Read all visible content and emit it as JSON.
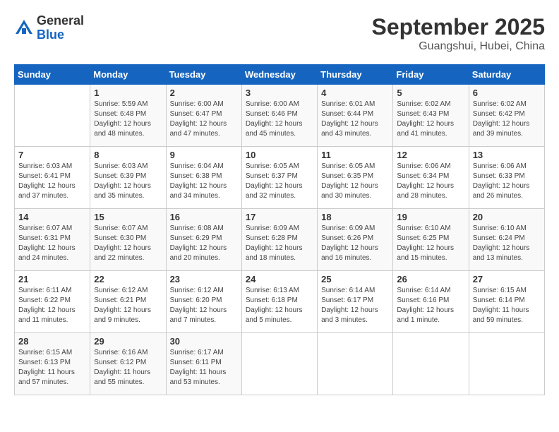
{
  "header": {
    "logo": {
      "general": "General",
      "blue": "Blue"
    },
    "title": "September 2025",
    "subtitle": "Guangshui, Hubei, China"
  },
  "days_of_week": [
    "Sunday",
    "Monday",
    "Tuesday",
    "Wednesday",
    "Thursday",
    "Friday",
    "Saturday"
  ],
  "weeks": [
    [
      {
        "day": "",
        "info": ""
      },
      {
        "day": "1",
        "info": "Sunrise: 5:59 AM\nSunset: 6:48 PM\nDaylight: 12 hours\nand 48 minutes."
      },
      {
        "day": "2",
        "info": "Sunrise: 6:00 AM\nSunset: 6:47 PM\nDaylight: 12 hours\nand 47 minutes."
      },
      {
        "day": "3",
        "info": "Sunrise: 6:00 AM\nSunset: 6:46 PM\nDaylight: 12 hours\nand 45 minutes."
      },
      {
        "day": "4",
        "info": "Sunrise: 6:01 AM\nSunset: 6:44 PM\nDaylight: 12 hours\nand 43 minutes."
      },
      {
        "day": "5",
        "info": "Sunrise: 6:02 AM\nSunset: 6:43 PM\nDaylight: 12 hours\nand 41 minutes."
      },
      {
        "day": "6",
        "info": "Sunrise: 6:02 AM\nSunset: 6:42 PM\nDaylight: 12 hours\nand 39 minutes."
      }
    ],
    [
      {
        "day": "7",
        "info": "Sunrise: 6:03 AM\nSunset: 6:41 PM\nDaylight: 12 hours\nand 37 minutes."
      },
      {
        "day": "8",
        "info": "Sunrise: 6:03 AM\nSunset: 6:39 PM\nDaylight: 12 hours\nand 35 minutes."
      },
      {
        "day": "9",
        "info": "Sunrise: 6:04 AM\nSunset: 6:38 PM\nDaylight: 12 hours\nand 34 minutes."
      },
      {
        "day": "10",
        "info": "Sunrise: 6:05 AM\nSunset: 6:37 PM\nDaylight: 12 hours\nand 32 minutes."
      },
      {
        "day": "11",
        "info": "Sunrise: 6:05 AM\nSunset: 6:35 PM\nDaylight: 12 hours\nand 30 minutes."
      },
      {
        "day": "12",
        "info": "Sunrise: 6:06 AM\nSunset: 6:34 PM\nDaylight: 12 hours\nand 28 minutes."
      },
      {
        "day": "13",
        "info": "Sunrise: 6:06 AM\nSunset: 6:33 PM\nDaylight: 12 hours\nand 26 minutes."
      }
    ],
    [
      {
        "day": "14",
        "info": "Sunrise: 6:07 AM\nSunset: 6:31 PM\nDaylight: 12 hours\nand 24 minutes."
      },
      {
        "day": "15",
        "info": "Sunrise: 6:07 AM\nSunset: 6:30 PM\nDaylight: 12 hours\nand 22 minutes."
      },
      {
        "day": "16",
        "info": "Sunrise: 6:08 AM\nSunset: 6:29 PM\nDaylight: 12 hours\nand 20 minutes."
      },
      {
        "day": "17",
        "info": "Sunrise: 6:09 AM\nSunset: 6:28 PM\nDaylight: 12 hours\nand 18 minutes."
      },
      {
        "day": "18",
        "info": "Sunrise: 6:09 AM\nSunset: 6:26 PM\nDaylight: 12 hours\nand 16 minutes."
      },
      {
        "day": "19",
        "info": "Sunrise: 6:10 AM\nSunset: 6:25 PM\nDaylight: 12 hours\nand 15 minutes."
      },
      {
        "day": "20",
        "info": "Sunrise: 6:10 AM\nSunset: 6:24 PM\nDaylight: 12 hours\nand 13 minutes."
      }
    ],
    [
      {
        "day": "21",
        "info": "Sunrise: 6:11 AM\nSunset: 6:22 PM\nDaylight: 12 hours\nand 11 minutes."
      },
      {
        "day": "22",
        "info": "Sunrise: 6:12 AM\nSunset: 6:21 PM\nDaylight: 12 hours\nand 9 minutes."
      },
      {
        "day": "23",
        "info": "Sunrise: 6:12 AM\nSunset: 6:20 PM\nDaylight: 12 hours\nand 7 minutes."
      },
      {
        "day": "24",
        "info": "Sunrise: 6:13 AM\nSunset: 6:18 PM\nDaylight: 12 hours\nand 5 minutes."
      },
      {
        "day": "25",
        "info": "Sunrise: 6:14 AM\nSunset: 6:17 PM\nDaylight: 12 hours\nand 3 minutes."
      },
      {
        "day": "26",
        "info": "Sunrise: 6:14 AM\nSunset: 6:16 PM\nDaylight: 12 hours\nand 1 minute."
      },
      {
        "day": "27",
        "info": "Sunrise: 6:15 AM\nSunset: 6:14 PM\nDaylight: 11 hours\nand 59 minutes."
      }
    ],
    [
      {
        "day": "28",
        "info": "Sunrise: 6:15 AM\nSunset: 6:13 PM\nDaylight: 11 hours\nand 57 minutes."
      },
      {
        "day": "29",
        "info": "Sunrise: 6:16 AM\nSunset: 6:12 PM\nDaylight: 11 hours\nand 55 minutes."
      },
      {
        "day": "30",
        "info": "Sunrise: 6:17 AM\nSunset: 6:11 PM\nDaylight: 11 hours\nand 53 minutes."
      },
      {
        "day": "",
        "info": ""
      },
      {
        "day": "",
        "info": ""
      },
      {
        "day": "",
        "info": ""
      },
      {
        "day": "",
        "info": ""
      }
    ]
  ]
}
